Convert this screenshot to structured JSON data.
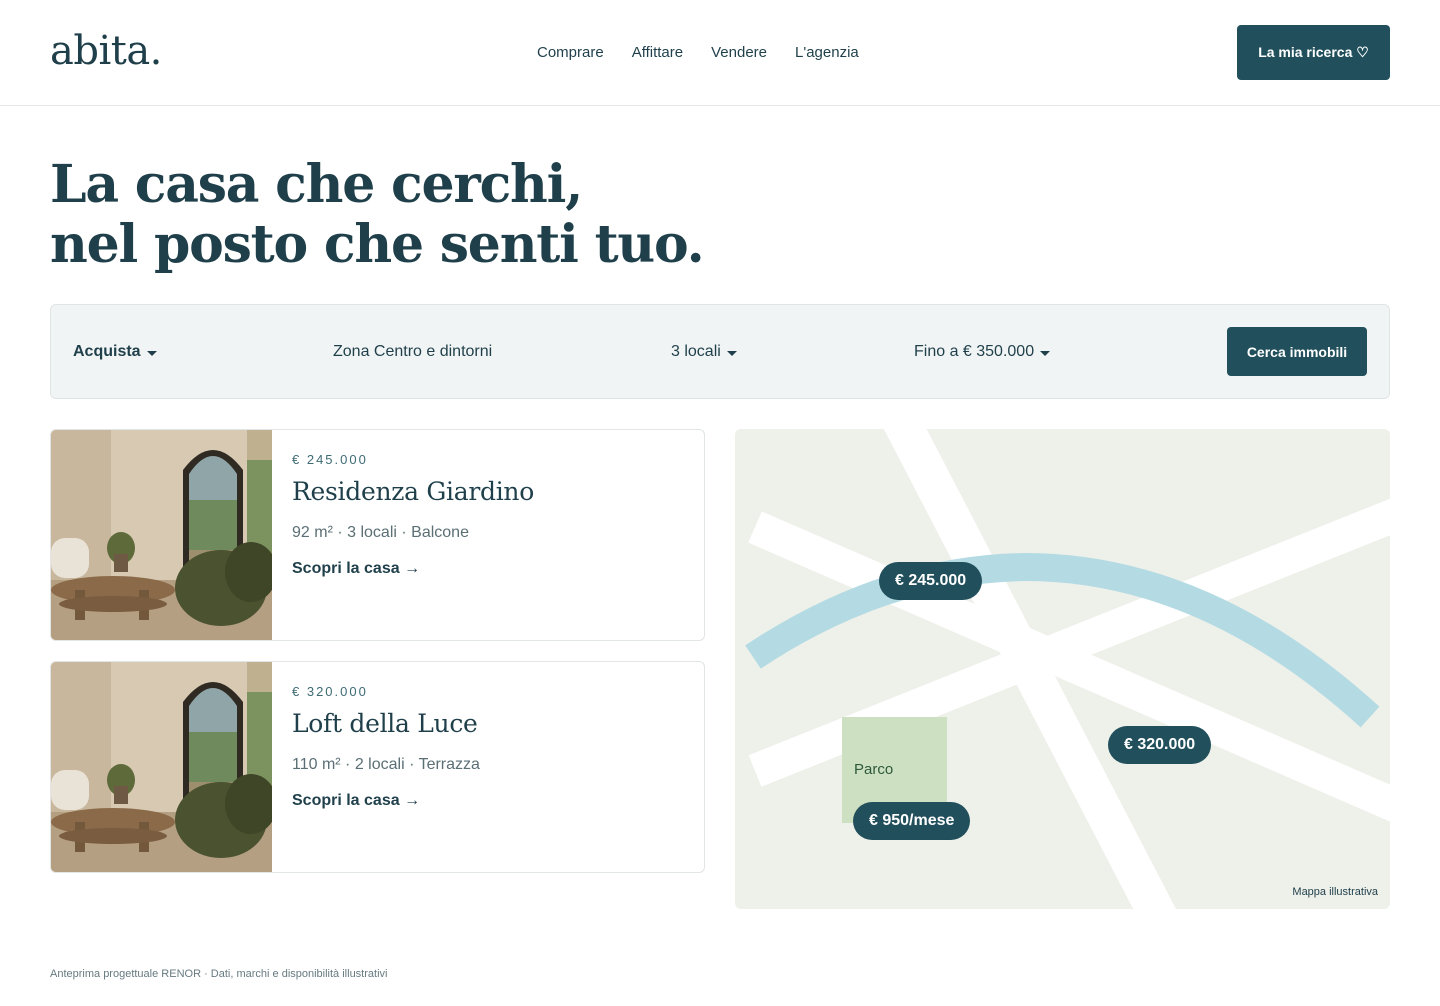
{
  "header": {
    "logo": "abita.",
    "nav": [
      "Comprare",
      "Affittare",
      "Vendere",
      "L'agenzia"
    ],
    "cta_label": "La mia ricerca ♡"
  },
  "hero": {
    "line1": "La casa che cerchi,",
    "line2": "nel posto che senti tuo."
  },
  "search": {
    "mode": "Acquista",
    "zone": "Zona Centro e dintorni",
    "rooms": "3 locali",
    "budget": "Fino a € 350.000",
    "submit_label": "Cerca immobili"
  },
  "listings": [
    {
      "price": "€ 245.000",
      "title": "Residenza Giardino",
      "specs": "92 m² · 3 locali · Balcone",
      "link": "Scopri la casa →"
    },
    {
      "price": "€ 320.000",
      "title": "Loft della Luce",
      "specs": "110 m² · 2 locali · Terrazza",
      "link": "Scopri la casa →"
    }
  ],
  "map": {
    "pins": [
      "€ 245.000",
      "€ 320.000",
      "€ 950/mese"
    ],
    "park_label": "Parco",
    "note": "Mappa illustrativa",
    "colors": {
      "land": "#eef0ea",
      "road": "#ffffff",
      "river": "#b4dbe3",
      "park": "#cde0c1",
      "pin": "#21505c"
    }
  },
  "footer": {
    "text": "Anteprima progettuale RENOR · Dati, marchi e disponibilità illustrativi"
  },
  "theme": {
    "primary": "#21505c",
    "text": "#1f3f4a",
    "panel": "#f1f4f4"
  }
}
